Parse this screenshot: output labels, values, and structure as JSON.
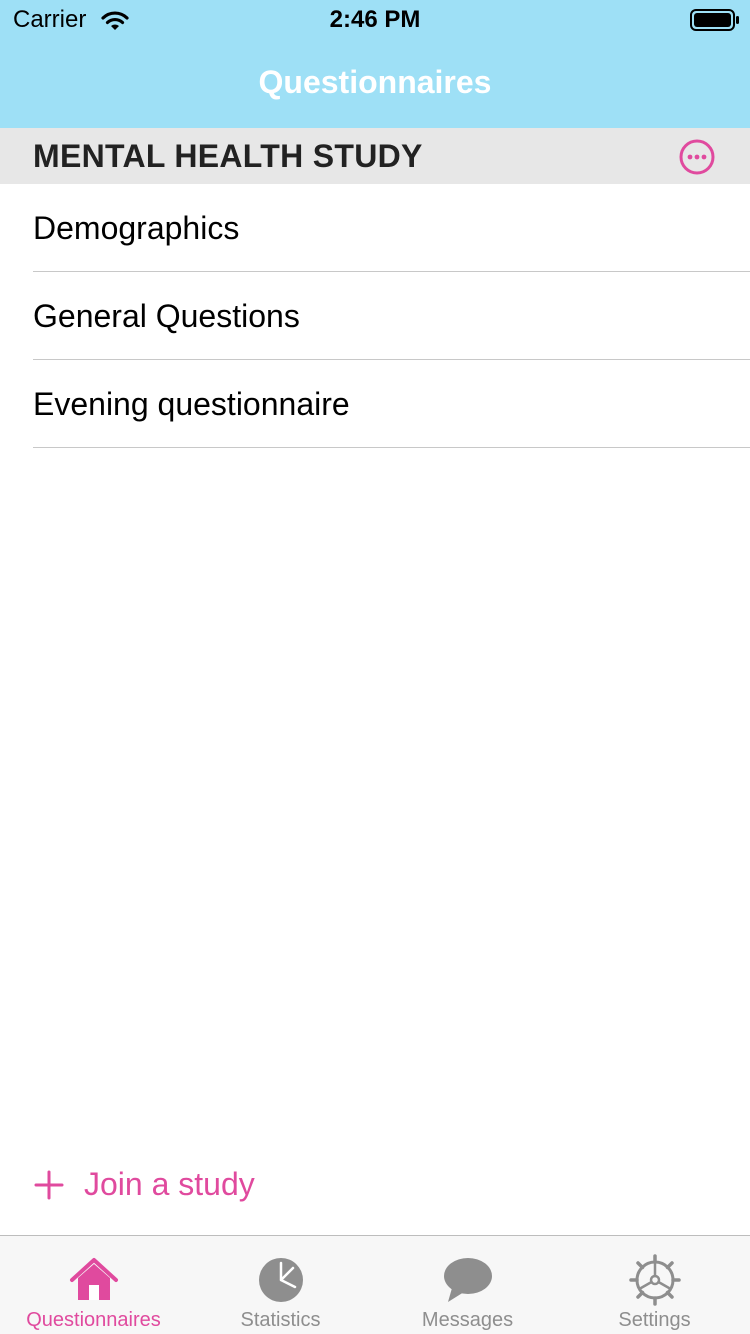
{
  "status_bar": {
    "carrier": "Carrier",
    "time": "2:46 PM"
  },
  "nav": {
    "title": "Questionnaires"
  },
  "section": {
    "title": "MENTAL HEALTH STUDY",
    "more_icon": "ellipsis-circle-icon"
  },
  "questionnaires": [
    {
      "label": "Demographics"
    },
    {
      "label": "General Questions"
    },
    {
      "label": "Evening questionnaire"
    }
  ],
  "join": {
    "label": "Join a study",
    "icon": "plus-icon"
  },
  "tabs": [
    {
      "label": "Questionnaires",
      "icon": "house-icon",
      "active": true
    },
    {
      "label": "Statistics",
      "icon": "pie-chart-icon",
      "active": false
    },
    {
      "label": "Messages",
      "icon": "speech-bubble-icon",
      "active": false
    },
    {
      "label": "Settings",
      "icon": "gear-icon",
      "active": false
    }
  ],
  "colors": {
    "bar_background": "#9ee0f6",
    "accent": "#e04a9e",
    "section_background": "#e7e7e7",
    "inactive_tab": "#8e8e8e"
  }
}
